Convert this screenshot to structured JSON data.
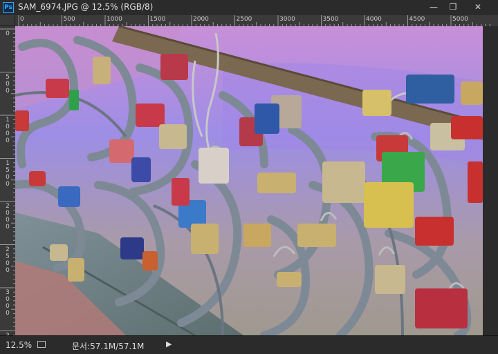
{
  "window": {
    "app_icon_text": "Ps",
    "title": "SAM_6974.JPG @ 12.5% (RGB/8)",
    "minimize_glyph": "—",
    "maximize_glyph": "❐",
    "close_glyph": "✕"
  },
  "ruler": {
    "horizontal_labels": [
      "0",
      "500",
      "1000",
      "1500",
      "2000",
      "2500",
      "3000",
      "3500",
      "4000",
      "4500",
      "5000"
    ],
    "vertical_labels": [
      "0",
      "500",
      "1000",
      "1500",
      "2000",
      "2500",
      "3000",
      "3"
    ]
  },
  "status": {
    "zoom": "12.5%",
    "doc_size": "문서:57.1M/57.1M",
    "menu_arrow": "▶"
  },
  "colors": {
    "sky": "#b48fd6",
    "railing": "#7f8a96",
    "rust": "#8a6a4a"
  }
}
